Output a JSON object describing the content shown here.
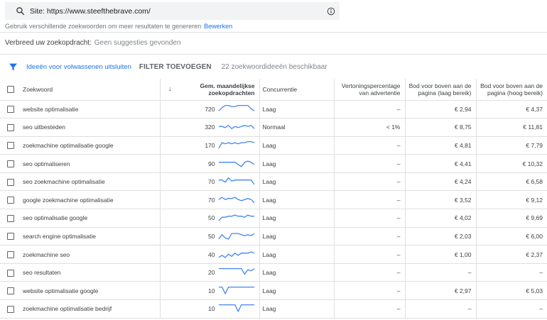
{
  "search": {
    "text": "Site: https://www.steefthebrave.com/",
    "hint": "Gebruik verschillende zoekwoorden om meer resultaten te genereren",
    "edit_link": "Bewerken"
  },
  "broaden": {
    "label": "Verbreed uw zoekopdracht:",
    "value": "Geen suggesties gevonden"
  },
  "filterbar": {
    "exclude_label": "Ideeën voor volwassenen uitsluiten",
    "add_filter_label": "FILTER TOEVOEGEN",
    "count_label": "22 zoekwoordideeën beschikbaar"
  },
  "table": {
    "headers": {
      "keyword": "Zoekwoord",
      "sort_arrow": "↓",
      "volume": "Gem. maandelijkse zoekopdrachten",
      "competition": "Concurrentie",
      "impression_share": "Vertoningspercentage van advertentie",
      "bid_low": "Bod voor boven aan de pagina (laag bereik)",
      "bid_high": "Bod voor boven aan de pagina (hoog bereik)"
    },
    "rows": [
      {
        "keyword": "website optimalisatie",
        "volume": "720",
        "trend": [
          3,
          6,
          8,
          8,
          7,
          7,
          8,
          8,
          8,
          8,
          5,
          3
        ],
        "competition": "Laag",
        "impression": "–",
        "bid_low": "€ 2,94",
        "bid_high": "€ 4,37"
      },
      {
        "keyword": "seo uitbesteden",
        "volume": "320",
        "trend": [
          5,
          5,
          4,
          6,
          3,
          5,
          4,
          5,
          6,
          5,
          6,
          3
        ],
        "competition": "Normaal",
        "impression": "< 1%",
        "bid_low": "€ 8,75",
        "bid_high": "€ 11,81"
      },
      {
        "keyword": "zoekmachine optimalisatie google",
        "volume": "170",
        "trend": [
          2,
          7,
          6,
          7,
          6,
          7,
          6,
          7,
          7,
          8,
          8,
          7
        ],
        "competition": "Laag",
        "impression": "–",
        "bid_low": "€ 4,81",
        "bid_high": "€ 7,79"
      },
      {
        "keyword": "seo optimaliseren",
        "volume": "90",
        "trend": [
          6,
          6,
          6,
          6,
          6,
          6,
          4,
          2,
          6,
          7,
          6,
          4
        ],
        "competition": "Laag",
        "impression": "–",
        "bid_low": "€ 4,41",
        "bid_high": "€ 10,32"
      },
      {
        "keyword": "seo zoekmachine optimalisatie",
        "volume": "70",
        "trend": [
          6,
          6,
          4,
          8,
          5,
          6,
          6,
          6,
          6,
          6,
          6,
          2
        ],
        "competition": "Laag",
        "impression": "–",
        "bid_low": "€ 4,24",
        "bid_high": "€ 6,58"
      },
      {
        "keyword": "google zoekmachine optimalisatie",
        "volume": "70",
        "trend": [
          5,
          7,
          5,
          6,
          6,
          7,
          5,
          4,
          5,
          6,
          5,
          2
        ],
        "competition": "Laag",
        "impression": "–",
        "bid_low": "€ 3,52",
        "bid_high": "€ 9,12"
      },
      {
        "keyword": "seo optimalisatie google",
        "volume": "50",
        "trend": [
          2,
          5,
          5,
          6,
          6,
          7,
          6,
          6,
          5,
          7,
          6,
          6
        ],
        "competition": "Laag",
        "impression": "–",
        "bid_low": "€ 4,02",
        "bid_high": "€ 9,69"
      },
      {
        "keyword": "search engine optimalisatie",
        "volume": "50",
        "trend": [
          2,
          6,
          3,
          2,
          7,
          7,
          7,
          6,
          5,
          6,
          5,
          7
        ],
        "competition": "Laag",
        "impression": "–",
        "bid_low": "€ 2,03",
        "bid_high": "€ 6,00"
      },
      {
        "keyword": "zoekmachine seo",
        "volume": "40",
        "trend": [
          2,
          4,
          2,
          5,
          3,
          6,
          4,
          6,
          6,
          6,
          7,
          6
        ],
        "competition": "Laag",
        "impression": "–",
        "bid_low": "€ 1,00",
        "bid_high": "€ 2,37"
      },
      {
        "keyword": "seo resultaten",
        "volume": "20",
        "trend": [
          8,
          8,
          8,
          8,
          8,
          8,
          8,
          8,
          3,
          7,
          6,
          8
        ],
        "competition": "Laag",
        "impression": "–",
        "bid_low": "–",
        "bid_high": "–"
      },
      {
        "keyword": "website optimalisatie google",
        "volume": "10",
        "trend": [
          8,
          8,
          2,
          8,
          8,
          8,
          8,
          8,
          8,
          8,
          8,
          8
        ],
        "competition": "Laag",
        "impression": "–",
        "bid_low": "€ 2,97",
        "bid_high": "€ 5,03"
      },
      {
        "keyword": "zoekmachine optimalisatie bedrijf",
        "volume": "10",
        "trend": [
          8,
          8,
          8,
          8,
          8,
          8,
          2,
          8,
          8,
          8,
          8,
          8
        ],
        "competition": "Laag",
        "impression": "–",
        "bid_low": "–",
        "bid_high": "–"
      }
    ]
  },
  "colors": {
    "accent": "#1a73e8",
    "sparkline": "#4285f4",
    "divider": "#e0e0e0"
  },
  "icons": {
    "search": "search-icon",
    "info": "info-icon",
    "filter": "filter-icon",
    "sort": "arrow-down-icon"
  }
}
